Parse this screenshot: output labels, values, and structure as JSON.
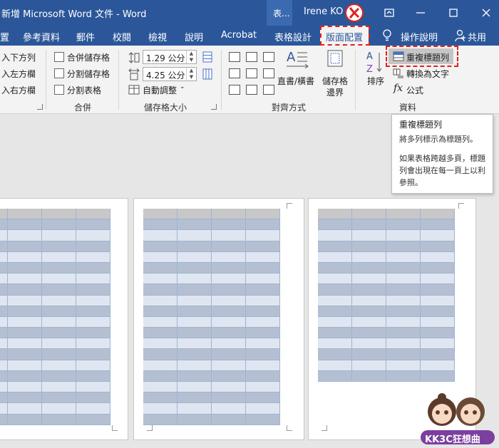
{
  "window": {
    "title": "新增 Microsoft Word 文件 - Word",
    "context_tab": "表...",
    "user_name": "Irene KO"
  },
  "tabs": [
    {
      "label": "置"
    },
    {
      "label": "參考資料"
    },
    {
      "label": "郵件"
    },
    {
      "label": "校閱"
    },
    {
      "label": "檢視"
    },
    {
      "label": "說明"
    },
    {
      "label": "Acrobat"
    },
    {
      "label": "表格設計"
    },
    {
      "label": "版面配置"
    },
    {
      "label": "操作說明"
    },
    {
      "label": "共用"
    }
  ],
  "ribbon": {
    "insert_group": {
      "below": "入下方列",
      "left": "入左方欄",
      "right": "入右方欄"
    },
    "merge_group": {
      "merge_cells": "合併儲存格",
      "split_cells": "分割儲存格",
      "split_table": "分割表格",
      "label": "合併"
    },
    "size_group": {
      "height": "1.29 公分",
      "width": "4.25 公分",
      "autofit": "自動調整",
      "label": "儲存格大小"
    },
    "align_group": {
      "text_direction": "直書/橫書",
      "cell_margins_line1": "儲存格",
      "cell_margins_line2": "邊界",
      "label": "對齊方式"
    },
    "data_group": {
      "sort": "排序",
      "repeat_header": "重複標題列",
      "convert_text": "轉換為文字",
      "formula": "公式",
      "label": "資料"
    }
  },
  "tooltip": {
    "title": "重複標題列",
    "line1": "將多列標示為標題列。",
    "line2": "如果表格跨越多頁，標題列會出現在每一頁上以利參照。"
  },
  "watermark": {
    "text": "KK3C狂想曲"
  },
  "colors": {
    "title_bar": "#2b579a",
    "ribbon_bg": "#f3f3f3",
    "highlight": "#e02020"
  }
}
